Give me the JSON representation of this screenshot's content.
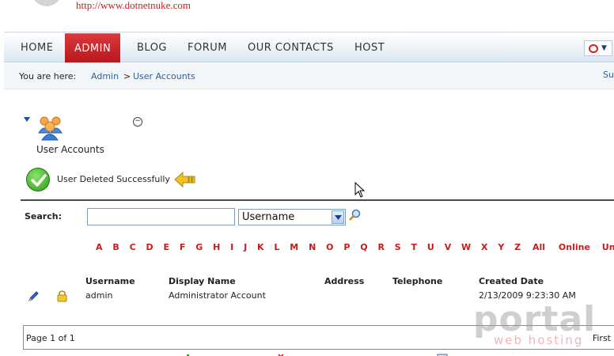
{
  "header": {
    "site_url": "http://www.dotnetnuke.com",
    "logo_icon": "dotnetnuke-logo-icon"
  },
  "nav": {
    "items": [
      {
        "label": "HOME",
        "active": false
      },
      {
        "label": "ADMIN",
        "active": true
      },
      {
        "label": "BLOG",
        "active": false
      },
      {
        "label": "FORUM",
        "active": false
      },
      {
        "label": "OUR CONTACTS",
        "active": false
      },
      {
        "label": "HOST",
        "active": false
      }
    ],
    "language_icon": "language-flag-icon"
  },
  "breadcrumb": {
    "label": "You are here:",
    "items": [
      "Admin",
      "User Accounts"
    ],
    "separator": ">",
    "right_link": "Su"
  },
  "module": {
    "title": "User Accounts",
    "icon": "users-icon",
    "minimize_symbol": "−"
  },
  "message": {
    "text": "User Deleted Successfully",
    "icon": "success-check-icon"
  },
  "search": {
    "label": "Search:",
    "value": "",
    "field_selected": "Username"
  },
  "letters": [
    "A",
    "B",
    "C",
    "D",
    "E",
    "F",
    "G",
    "H",
    "I",
    "J",
    "K",
    "L",
    "M",
    "N",
    "O",
    "P",
    "Q",
    "R",
    "S",
    "T",
    "U",
    "V",
    "W",
    "X",
    "Y",
    "Z"
  ],
  "letter_filters": [
    "All",
    "Online",
    "Unauth"
  ],
  "grid": {
    "columns": [
      "Username",
      "Display Name",
      "Address",
      "Telephone",
      "Created Date"
    ],
    "rows": [
      {
        "username": "admin",
        "display_name": "Administrator Account",
        "address": "",
        "telephone": "",
        "created": "2/13/2009 9:23:30 AM"
      }
    ]
  },
  "pager": {
    "status": "Page 1 of 1",
    "first": "First"
  },
  "watermark": {
    "main": "portal",
    "sub": "web hosting"
  },
  "colors": {
    "accent_red": "#c81c1c",
    "link_blue": "#2a5f9e",
    "nav_active_bg": "#c0282c"
  }
}
